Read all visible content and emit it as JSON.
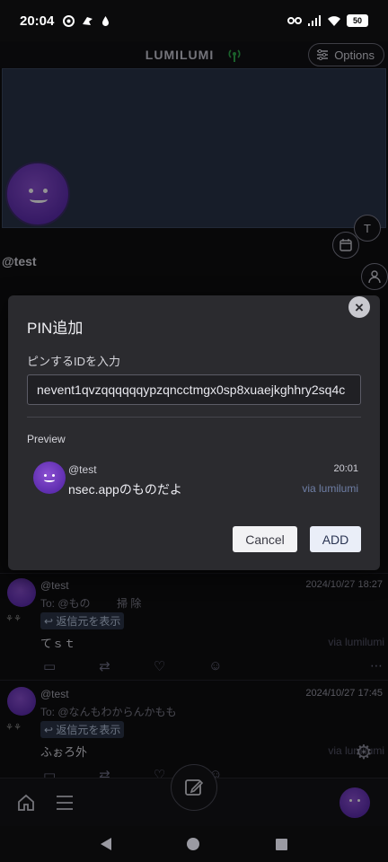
{
  "status_bar": {
    "time": "20:04",
    "battery": "50"
  },
  "app": {
    "title": "LUMILUMI",
    "options_label": "Options"
  },
  "profile": {
    "handle": "@test",
    "side_button_letter": "T"
  },
  "feed": [
    {
      "handle": "@test",
      "time": "2024/10/27 18:27",
      "to": "To: @もの",
      "to_extra": "掃 除",
      "reply_button": "返信元を表示",
      "content": "てｓｔ",
      "via": "via lumilumi"
    },
    {
      "handle": "@test",
      "time": "2024/10/27 17:45",
      "to": "To: @なんもわからんかもも",
      "reply_button": "返信元を表示",
      "content": "ふぉろ外",
      "via": "via lumilumi"
    }
  ],
  "dialog": {
    "title": "PIN追加",
    "input_label": "ピンするIDを入力",
    "input_value": "nevent1qvzqqqqqqypzqncctmgx0sp8xuaejkghhry2sq4c",
    "preview_label": "Preview",
    "preview": {
      "handle": "@test",
      "time": "20:01",
      "content": "nsec.appのものだよ",
      "via": "via lumilumi"
    },
    "cancel_label": "Cancel",
    "add_label": "ADD"
  },
  "colors": {
    "accent_purple": "#6b35b8",
    "relay_green": "#2ea84a",
    "via_blue": "#6f7fa6"
  },
  "icons": [
    "relay-icon",
    "options-icon",
    "calendar-icon",
    "user-icon",
    "reply-icon",
    "repost-icon",
    "like-icon",
    "react-icon",
    "more-icon",
    "home-icon",
    "menu-icon",
    "compose-icon",
    "gear-icon",
    "close-icon"
  ]
}
